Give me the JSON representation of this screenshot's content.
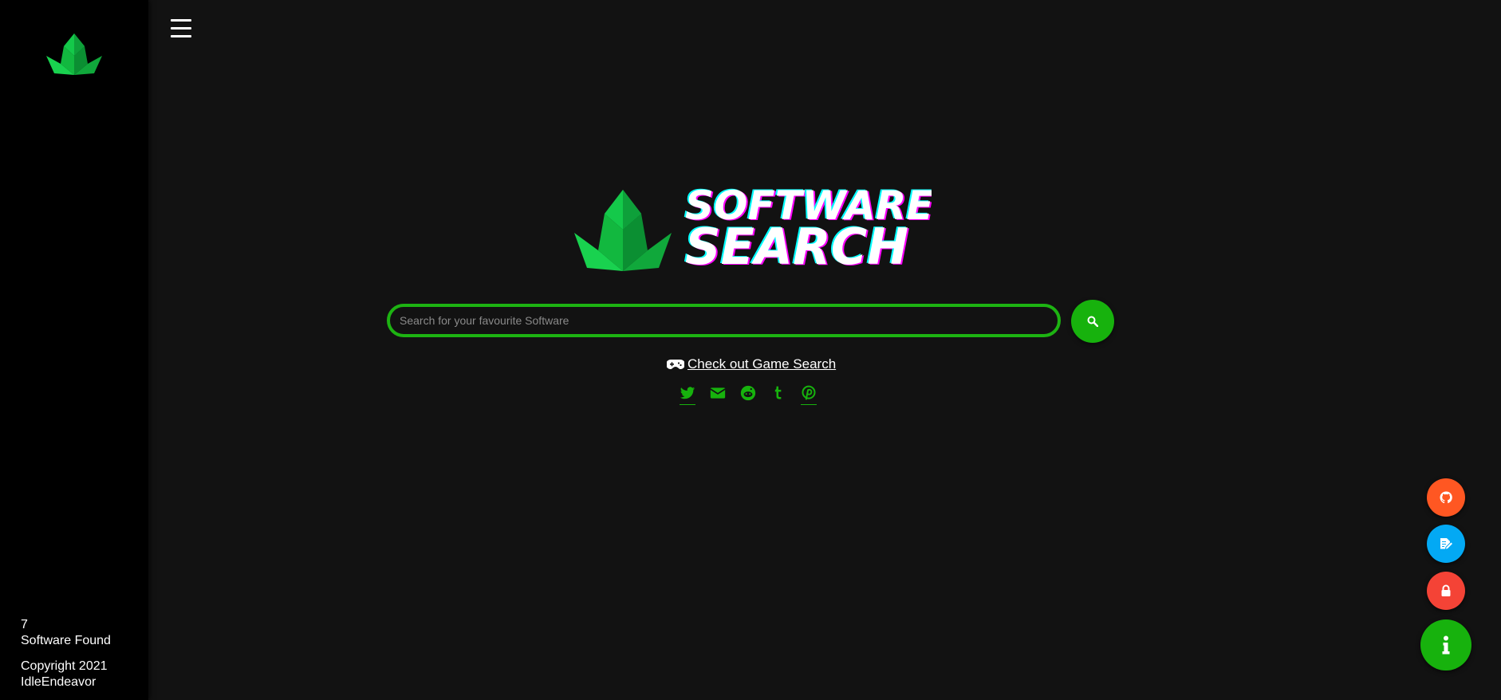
{
  "sidebar": {
    "software_count": "7",
    "software_found_label": "Software Found",
    "copyright": "Copyright 2021",
    "author": "IdleEndeavor"
  },
  "header": {
    "menu_icon": "hamburger-icon"
  },
  "hero": {
    "logo_line1": "SOFTWARE",
    "logo_line2": "SEARCH"
  },
  "search": {
    "placeholder": "Search for your favourite Software",
    "value": "",
    "button_icon": "search-icon"
  },
  "game_link": {
    "label": "Check out Game Search",
    "icon": "gamepad-icon"
  },
  "social": {
    "icons": [
      "twitter-icon",
      "email-icon",
      "reddit-icon",
      "tumblr-icon",
      "pinterest-icon"
    ]
  },
  "fabs": {
    "icons": [
      "github-icon",
      "edit-icon",
      "lock-icon",
      "info-icon"
    ]
  },
  "colors": {
    "background": "#121212",
    "sidebar": "#000000",
    "accent_green": "#17b20d",
    "github_fab": "#ff5722",
    "edit_fab": "#03a9f4",
    "lock_fab": "#f44336",
    "logo_magenta": "#ff00ff",
    "logo_cyan": "#00ffff"
  }
}
